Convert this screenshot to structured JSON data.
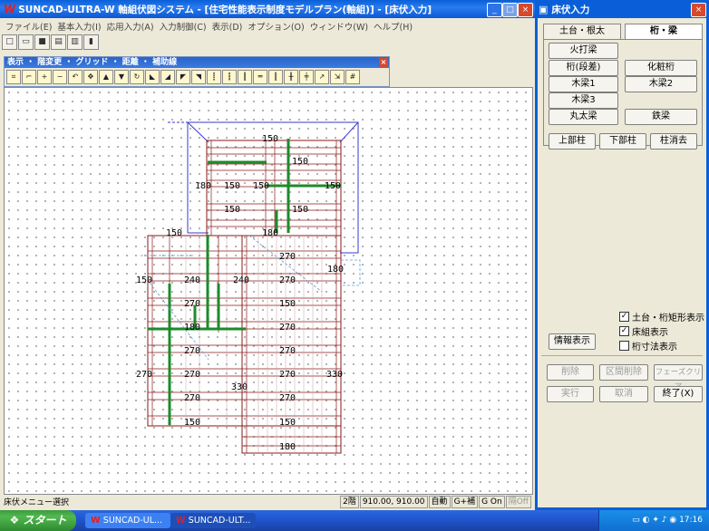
{
  "main": {
    "title": "SUNCAD-ULTRA-W 軸組伏図システム - [住宅性能表示制度モデルプラン(軸組)] - [床伏入力]",
    "logo": "W",
    "menus": [
      "ファイル(E)",
      "基本入力(I)",
      "応用入力(A)",
      "入力制御(C)",
      "表示(D)",
      "オプション(O)",
      "ウィンドウ(W)",
      "ヘルプ(H)"
    ],
    "subtoolbar_title": "表示 ・ 階変更 ・ グリッド ・ 距離 ・ 補助線",
    "status": {
      "message": "床伏メニュー選択",
      "floor": "2階",
      "coords": "910.00, 910.00",
      "mode": "自動",
      "gplus": "G+補",
      "gon": "G On",
      "snap": "隔Off"
    }
  },
  "plan_labels": [
    {
      "t": "150"
    },
    {
      "t": "150"
    },
    {
      "t": "180"
    },
    {
      "t": "150"
    },
    {
      "t": "150"
    },
    {
      "t": "150"
    },
    {
      "t": "150"
    },
    {
      "t": "150"
    },
    {
      "t": "150"
    },
    {
      "t": "180"
    },
    {
      "t": "270"
    },
    {
      "t": "180"
    },
    {
      "t": "150"
    },
    {
      "t": "240"
    },
    {
      "t": "240"
    },
    {
      "t": "270"
    },
    {
      "t": "270"
    },
    {
      "t": "150"
    },
    {
      "t": "180"
    },
    {
      "t": "270"
    },
    {
      "t": "270"
    },
    {
      "t": "270"
    },
    {
      "t": "270"
    },
    {
      "t": "270"
    },
    {
      "t": "270"
    },
    {
      "t": "330"
    },
    {
      "t": "330"
    },
    {
      "t": "270"
    },
    {
      "t": "270"
    },
    {
      "t": "150"
    },
    {
      "t": "150"
    },
    {
      "t": "180"
    }
  ],
  "panel": {
    "title": "床伏入力",
    "tabs": [
      "土台・根太",
      "桁・梁"
    ],
    "buttons": {
      "hiuchi": "火打梁",
      "keta_kakusa": "桁(段差)",
      "kesho": "化粧桁",
      "mokuryo1": "木梁1",
      "mokuryo2": "木梁2",
      "mokuryo3": "木梁3",
      "maruta": "丸太梁",
      "tekko": "鉄梁",
      "jobu": "上部柱",
      "kabu": "下部柱",
      "hashira_del": "柱消去"
    },
    "info_button": "情報表示",
    "checks": [
      {
        "label": "土台・桁矩形表示",
        "checked": true
      },
      {
        "label": "床組表示",
        "checked": true
      },
      {
        "label": "桁寸法表示",
        "checked": false
      }
    ],
    "bottom": {
      "delete": "削除",
      "range_delete": "区間削除",
      "phase_clear": "フェーズクリア",
      "run": "実行",
      "cancel": "取消",
      "finish": "終了(X)"
    }
  },
  "taskbar": {
    "start": "スタート",
    "items": [
      "SUNCAD-UL...",
      "SUNCAD-ULT..."
    ],
    "clock": "17:16"
  },
  "colors": {
    "titlebar": "#0a5fd8",
    "beam_green": "#1f8a2b",
    "joist": "#8b1a1a",
    "roof_line": "#3a3ad6"
  }
}
